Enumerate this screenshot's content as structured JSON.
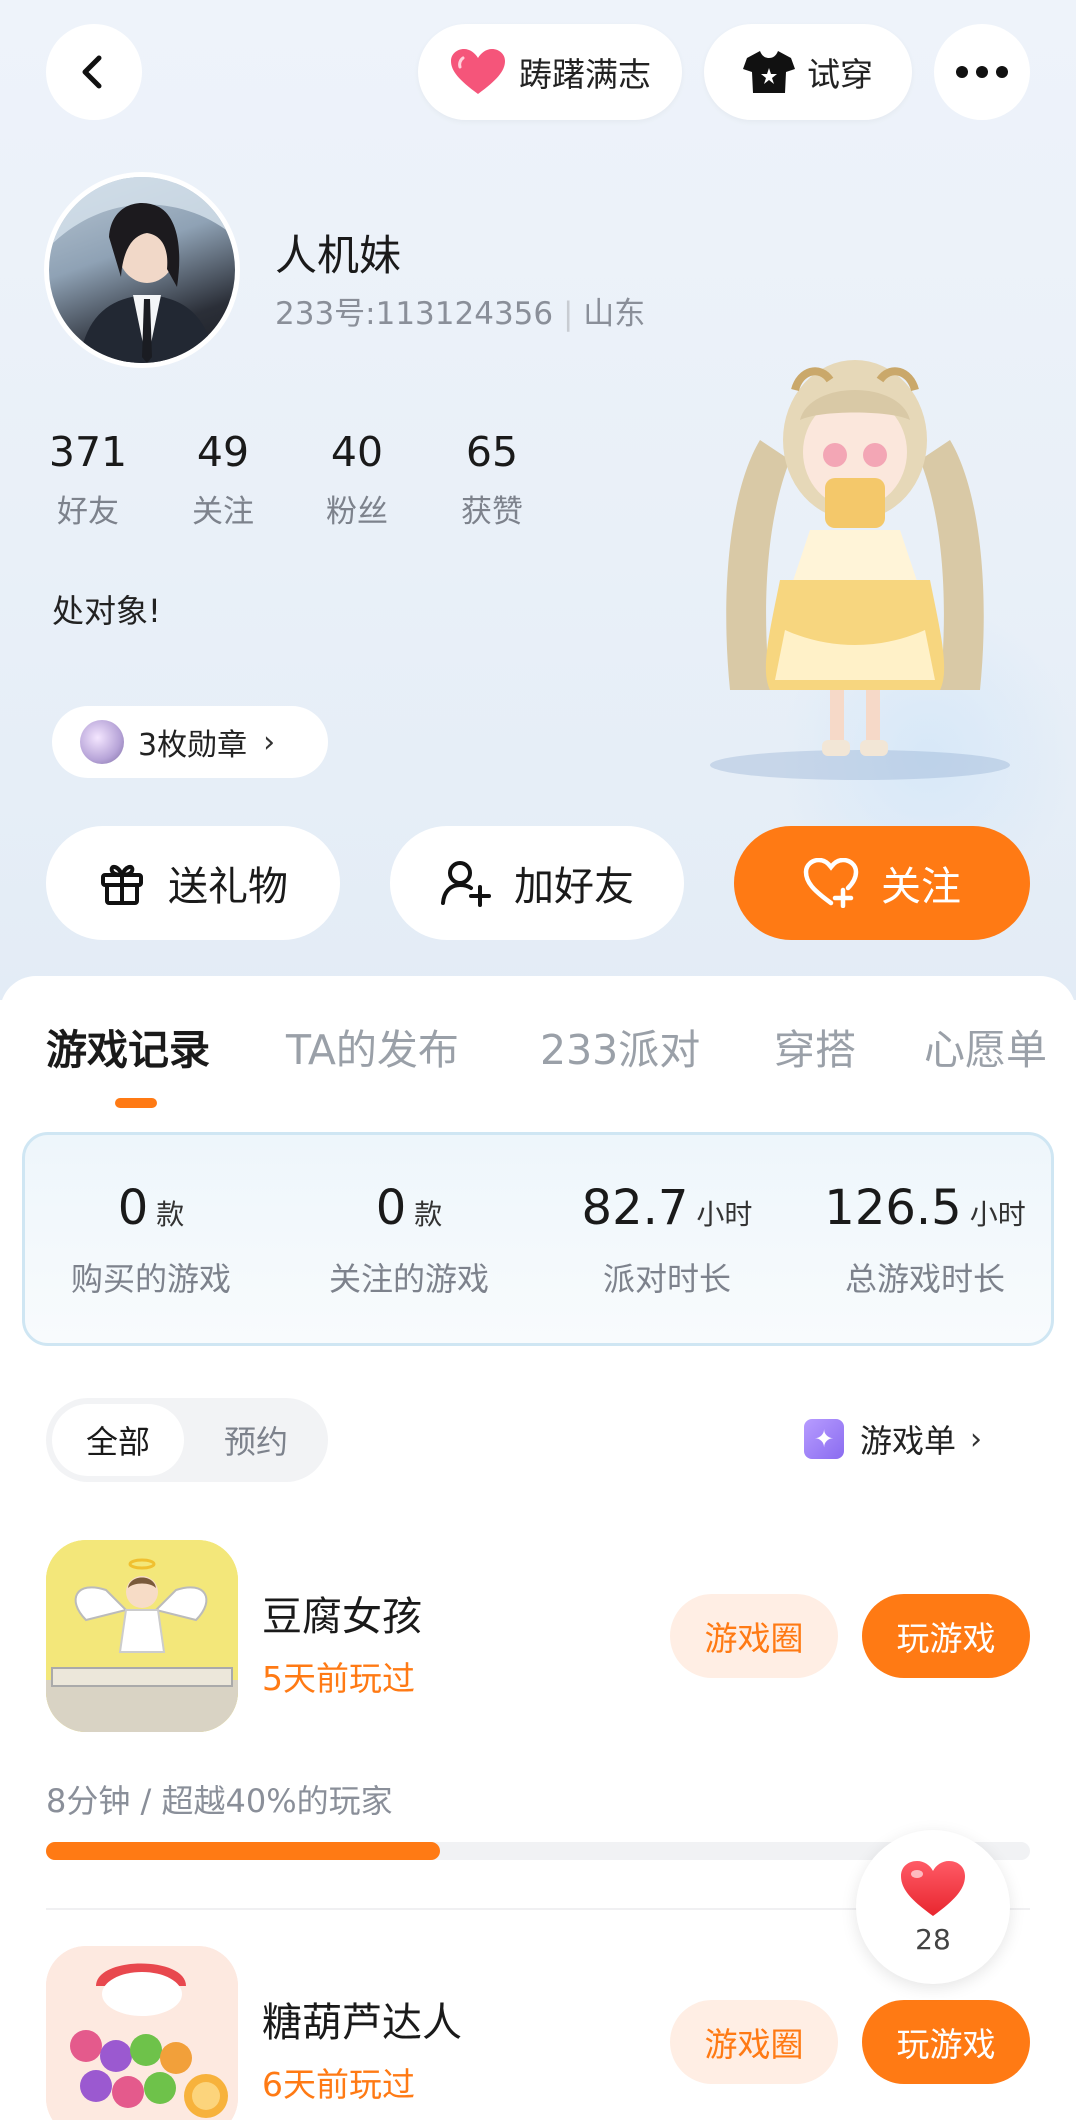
{
  "colors": {
    "accent": "#ff7a14",
    "accent_light": "#ffeee4",
    "text_muted": "#7d828c"
  },
  "top_bar": {
    "back_icon": "chevron-left-icon",
    "badge_label": "踌躇满志",
    "try_on_label": "试穿",
    "more_icon": "more-dots-icon"
  },
  "profile": {
    "name": "人机妹",
    "id_line": "233号:113124356",
    "region": "山东",
    "bio": "处对象!",
    "medals_label": "3枚勋章"
  },
  "stats": [
    {
      "value": "371",
      "label": "好友"
    },
    {
      "value": "49",
      "label": "关注"
    },
    {
      "value": "40",
      "label": "粉丝"
    },
    {
      "value": "65",
      "label": "获赞"
    }
  ],
  "actions": {
    "gift": "送礼物",
    "add_friend": "加好友",
    "follow": "关注"
  },
  "tabs": [
    {
      "label": "游戏记录",
      "active": true
    },
    {
      "label": "TA的发布",
      "active": false
    },
    {
      "label": "233派对",
      "active": false
    },
    {
      "label": "穿搭",
      "active": false
    },
    {
      "label": "心愿单",
      "active": false
    }
  ],
  "game_stats": [
    {
      "value": "0",
      "unit": "款",
      "label": "购买的游戏"
    },
    {
      "value": "0",
      "unit": "款",
      "label": "关注的游戏"
    },
    {
      "value": "82.7",
      "unit": "小时",
      "label": "派对时长"
    },
    {
      "value": "126.5",
      "unit": "小时",
      "label": "总游戏时长"
    }
  ],
  "filter": {
    "all": "全部",
    "reserved": "预约",
    "game_list": "游戏单"
  },
  "games": [
    {
      "title": "豆腐女孩",
      "last_played": "5天前玩过",
      "circle_label": "游戏圈",
      "play_label": "玩游戏",
      "play_meta": "8分钟 / 超越40%的玩家",
      "progress": 0.4
    },
    {
      "title": "糖葫芦达人",
      "last_played": "6天前玩过",
      "circle_label": "游戏圈",
      "play_label": "玩游戏"
    }
  ],
  "like_float": {
    "count": "28"
  }
}
